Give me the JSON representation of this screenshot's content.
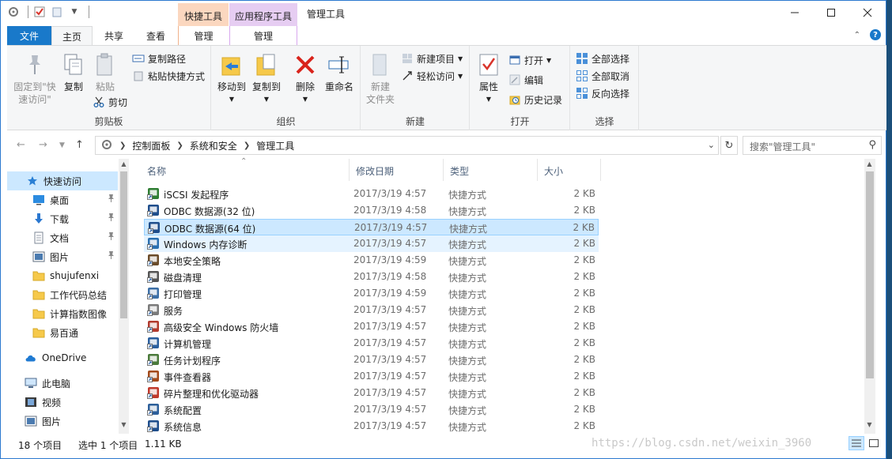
{
  "window": {
    "title": "管理工具",
    "context_tab_shortcut": "快捷工具",
    "context_tab_app": "应用程序工具",
    "controls": [
      "minimize-icon",
      "maximize-icon",
      "close-icon"
    ]
  },
  "tabs": {
    "file": "文件",
    "home": "主页",
    "share": "共享",
    "view": "查看",
    "manage1": "管理",
    "manage2": "管理"
  },
  "ribbon": {
    "clipboard": {
      "label": "剪贴板",
      "pin_line1": "固定到\"快",
      "pin_line2": "速访问\"",
      "copy": "复制",
      "paste": "粘贴",
      "copy_path": "复制路径",
      "paste_shortcut": "粘贴快捷方式",
      "cut": "剪切"
    },
    "organize": {
      "label": "组织",
      "move_to": "移动到",
      "copy_to": "复制到",
      "delete": "删除",
      "rename": "重命名"
    },
    "new": {
      "label": "新建",
      "new_folder_line1": "新建",
      "new_folder_line2": "文件夹",
      "new_item": "新建项目",
      "easy_access": "轻松访问"
    },
    "open": {
      "label": "打开",
      "properties": "属性",
      "open": "打开",
      "edit": "编辑",
      "history": "历史记录"
    },
    "select": {
      "label": "选择",
      "select_all": "全部选择",
      "select_none": "全部取消",
      "invert": "反向选择"
    }
  },
  "address": {
    "crumbs": [
      "控制面板",
      "系统和安全",
      "管理工具"
    ],
    "search_placeholder": "搜索\"管理工具\""
  },
  "nav": {
    "items": [
      {
        "label": "快速访问",
        "icon": "star-icon",
        "pinned": false
      },
      {
        "label": "桌面",
        "icon": "desktop-icon",
        "pinned": true
      },
      {
        "label": "下载",
        "icon": "download-icon",
        "pinned": true
      },
      {
        "label": "文档",
        "icon": "document-icon",
        "pinned": true
      },
      {
        "label": "图片",
        "icon": "pictures-icon",
        "pinned": true
      },
      {
        "label": "shujufenxi",
        "icon": "folder-icon",
        "pinned": false
      },
      {
        "label": "工作代码总结",
        "icon": "folder-icon",
        "pinned": false
      },
      {
        "label": "计算指数图像",
        "icon": "folder-icon",
        "pinned": false
      },
      {
        "label": "易百通",
        "icon": "folder-icon",
        "pinned": false
      },
      {
        "label": "OneDrive",
        "icon": "cloud-icon",
        "pinned": false
      },
      {
        "label": "此电脑",
        "icon": "computer-icon",
        "pinned": false
      },
      {
        "label": "视频",
        "icon": "video-icon",
        "pinned": false
      },
      {
        "label": "图片",
        "icon": "pictures-icon",
        "pinned": false
      }
    ]
  },
  "columns": {
    "name": "名称",
    "date": "修改日期",
    "type": "类型",
    "size": "大小"
  },
  "files": [
    {
      "name": "iSCSI 发起程序",
      "date": "2017/3/19 4:57",
      "type": "快捷方式",
      "size": "2 KB",
      "color": "#2e7d32"
    },
    {
      "name": "ODBC 数据源(32 位)",
      "date": "2017/3/19 4:58",
      "type": "快捷方式",
      "size": "2 KB",
      "color": "#1f4e8c"
    },
    {
      "name": "ODBC 数据源(64 位)",
      "date": "2017/3/19 4:57",
      "type": "快捷方式",
      "size": "2 KB",
      "color": "#1f4e8c"
    },
    {
      "name": "Windows 内存诊断",
      "date": "2017/3/19 4:57",
      "type": "快捷方式",
      "size": "2 KB",
      "color": "#2a6fb0"
    },
    {
      "name": "本地安全策略",
      "date": "2017/3/19 4:59",
      "type": "快捷方式",
      "size": "2 KB",
      "color": "#6b4c2a"
    },
    {
      "name": "磁盘清理",
      "date": "2017/3/19 4:58",
      "type": "快捷方式",
      "size": "2 KB",
      "color": "#555555"
    },
    {
      "name": "打印管理",
      "date": "2017/3/19 4:59",
      "type": "快捷方式",
      "size": "2 KB",
      "color": "#3d6fa6"
    },
    {
      "name": "服务",
      "date": "2017/3/19 4:57",
      "type": "快捷方式",
      "size": "2 KB",
      "color": "#7a7a7a"
    },
    {
      "name": "高级安全 Windows 防火墙",
      "date": "2017/3/19 4:57",
      "type": "快捷方式",
      "size": "2 KB",
      "color": "#b23a2e"
    },
    {
      "name": "计算机管理",
      "date": "2017/3/19 4:57",
      "type": "快捷方式",
      "size": "2 KB",
      "color": "#2a5f9e"
    },
    {
      "name": "任务计划程序",
      "date": "2017/3/19 4:57",
      "type": "快捷方式",
      "size": "2 KB",
      "color": "#4a7a3a"
    },
    {
      "name": "事件查看器",
      "date": "2017/3/19 4:57",
      "type": "快捷方式",
      "size": "2 KB",
      "color": "#a34a1a"
    },
    {
      "name": "碎片整理和优化驱动器",
      "date": "2017/3/19 4:57",
      "type": "快捷方式",
      "size": "2 KB",
      "color": "#c0392b"
    },
    {
      "name": "系统配置",
      "date": "2017/3/19 4:57",
      "type": "快捷方式",
      "size": "2 KB",
      "color": "#2d5f9a"
    },
    {
      "name": "系统信息",
      "date": "2017/3/19 4:57",
      "type": "快捷方式",
      "size": "2 KB",
      "color": "#1f4e8c"
    }
  ],
  "selected_index": 2,
  "hover_index": 3,
  "status": {
    "count": "18 个项目",
    "selected": "选中 1 个项目",
    "size": "1.11 KB"
  },
  "watermark": "https://blog.csdn.net/weixin_3960"
}
